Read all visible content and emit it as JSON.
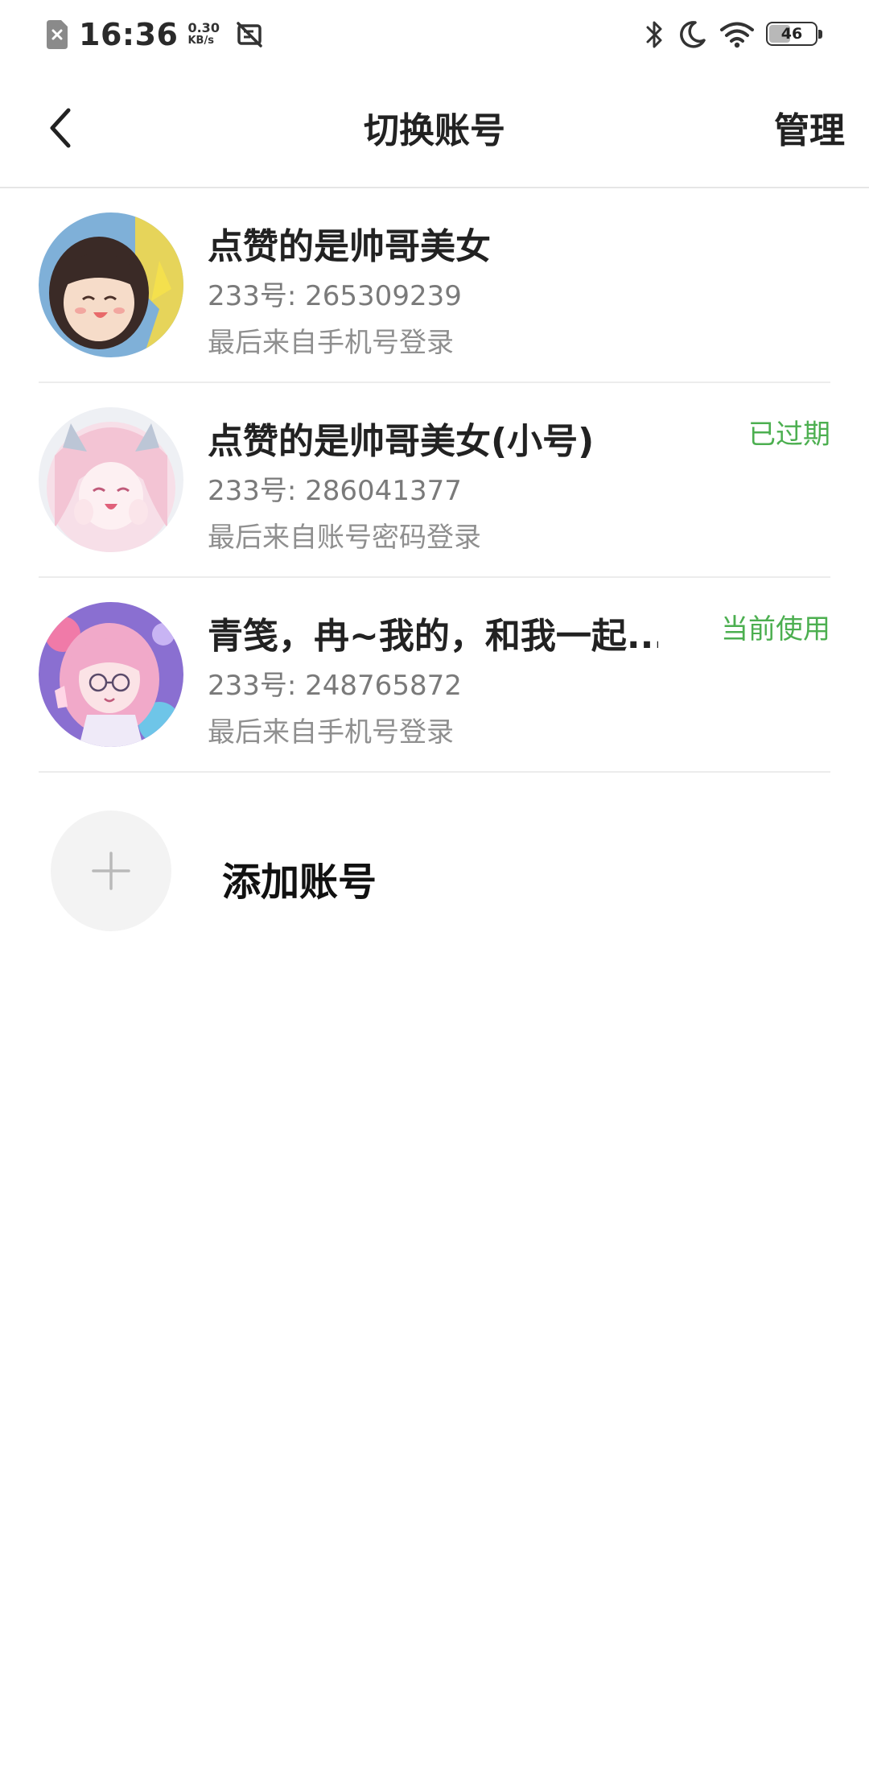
{
  "status_bar": {
    "time": "16:36",
    "speed_value": "0.30",
    "speed_unit": "KB/s",
    "battery_level": 46,
    "battery_text": "46",
    "icons": [
      "sim-card-icon",
      "no-sim-icon",
      "bluetooth-icon",
      "moon-icon",
      "wifi-icon",
      "battery-icon"
    ]
  },
  "header": {
    "title": "切换账号",
    "manage_label": "管理",
    "back_icon": "chevron-left-icon"
  },
  "accounts": [
    {
      "name": "点赞的是帅哥美女",
      "id_text": "233号: 265309239",
      "login_text": "最后来自手机号登录",
      "status": ""
    },
    {
      "name": "点赞的是帅哥美女(小号)",
      "id_text": "233号: 286041377",
      "login_text": "最后来自账号密码登录",
      "status": "已过期"
    },
    {
      "name": "青笺，冉~我的，和我一起...",
      "id_text": "233号: 248765872",
      "login_text": "最后来自手机号登录",
      "status": "当前使用"
    }
  ],
  "add_account": {
    "label": "添加账号",
    "icon": "plus-icon"
  },
  "colors": {
    "status_green": "#4caf50",
    "divider": "#ececec",
    "text_primary": "#222222",
    "text_secondary": "#7a7a7a"
  }
}
